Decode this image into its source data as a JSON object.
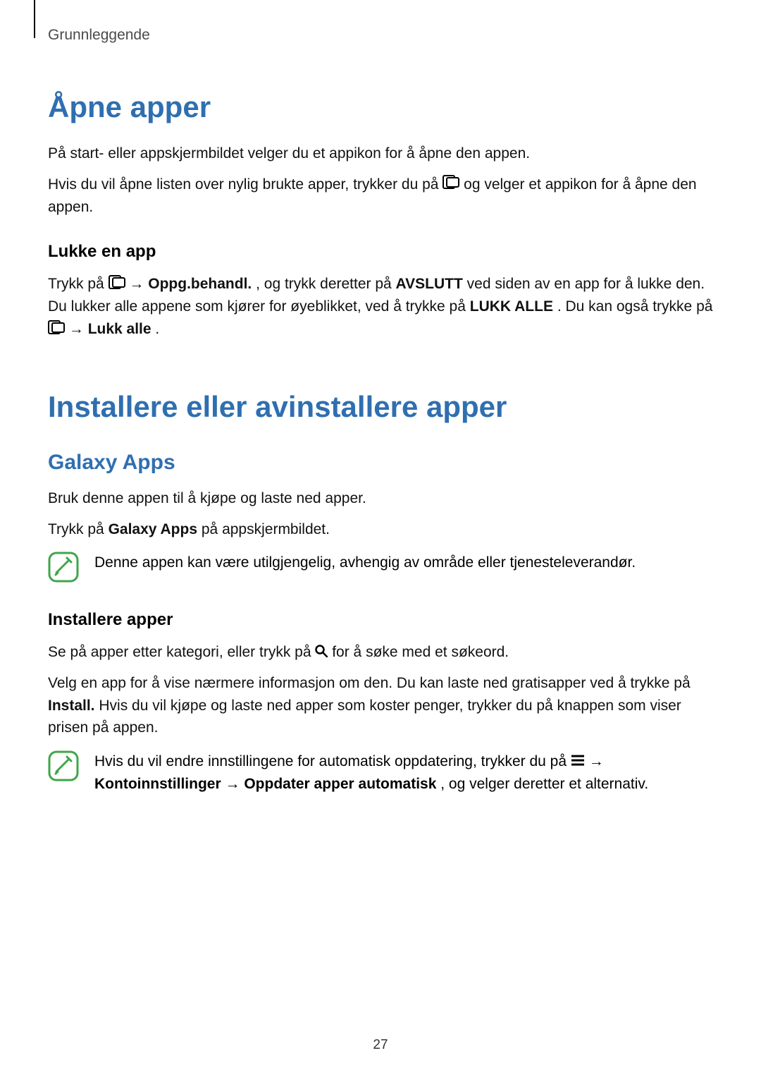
{
  "breadcrumb": "Grunnleggende",
  "sec1": {
    "h1": "Åpne apper",
    "p1": "På start- eller appskjermbildet velger du et appikon for å åpne den appen.",
    "p2a": "Hvis du vil åpne listen over nylig brukte apper, trykker du på ",
    "p2b": " og velger et appikon for å åpne den appen.",
    "h3": "Lukke en app",
    "p3a": "Trykk på ",
    "p3b": " → ",
    "p3c": "Oppg.behandl.",
    "p3d": ", og trykk deretter på ",
    "p3e": "AVSLUTT",
    "p3f": " ved siden av en app for å lukke den. Du lukker alle appene som kjører for øyeblikket, ved å trykke på ",
    "p3g": "LUKK ALLE",
    "p3h": ". Du kan også trykke på ",
    "p3i": " → ",
    "p3j": "Lukk alle",
    "p3k": "."
  },
  "sec2": {
    "h1": "Installere eller avinstallere apper",
    "h2": "Galaxy Apps",
    "p1": "Bruk denne appen til å kjøpe og laste ned apper.",
    "p2a": "Trykk på ",
    "p2b": "Galaxy Apps",
    "p2c": " på appskjermbildet.",
    "note1": "Denne appen kan være utilgjengelig, avhengig av område eller tjenesteleverandør.",
    "h3": "Installere apper",
    "p3a": "Se på apper etter kategori, eller trykk på ",
    "p3b": " for å søke med et søkeord.",
    "p4a": "Velg en app for å vise nærmere informasjon om den. Du kan laste ned gratisapper ved å trykke på ",
    "p4b": "Install.",
    "p4c": " Hvis du vil kjøpe og laste ned apper som koster penger, trykker du på knappen som viser prisen på appen.",
    "note2a": "Hvis du vil endre innstillingene for automatisk oppdatering, trykker du på ",
    "note2b": " → ",
    "note2c": "Kontoinnstillinger",
    "note2d": " → ",
    "note2e": "Oppdater apper automatisk",
    "note2f": ", og velger deretter et alternativ."
  },
  "page_number": "27"
}
